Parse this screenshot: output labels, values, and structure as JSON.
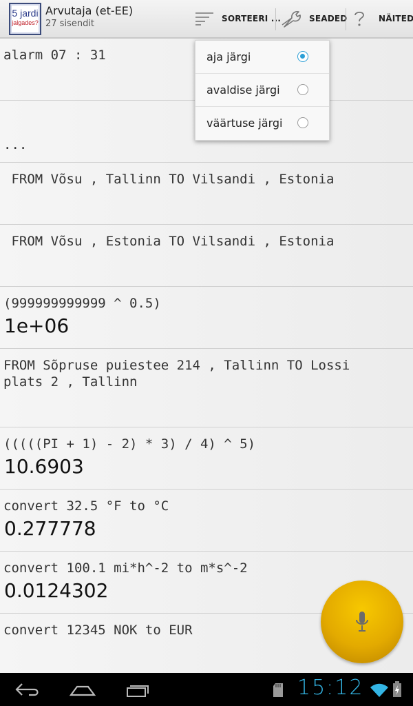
{
  "app": {
    "icon_line1": "5 jardi",
    "icon_line2": "jalgades?",
    "title": "Arvutaja (et-EE)",
    "subtitle": "27 sisendit"
  },
  "toolbar": {
    "sort_label": "SORTEERI ...",
    "settings_label": "SEADED",
    "examples_label": "NÄITED"
  },
  "sort_menu": {
    "options": [
      {
        "label": "aja järgi",
        "selected": true
      },
      {
        "label": "avaldise järgi",
        "selected": false
      },
      {
        "label": "väärtuse järgi",
        "selected": false
      }
    ]
  },
  "entries": [
    {
      "expression": "alarm 07 : 31",
      "result": ""
    },
    {
      "expression": "...",
      "result": ""
    },
    {
      "expression": " FROM Võsu , Tallinn TO Vilsandi , Estonia",
      "result": ""
    },
    {
      "expression": " FROM Võsu , Estonia TO Vilsandi , Estonia",
      "result": ""
    },
    {
      "expression": "(999999999999 ^ 0.5)",
      "result": "1e+06"
    },
    {
      "expression": "FROM Sõpruse puiestee 214 , Tallinn TO Lossi\nplats 2 , Tallinn",
      "result": ""
    },
    {
      "expression": "(((((PI + 1) - 2) * 3) / 4) ^ 5)",
      "result": "10.6903"
    },
    {
      "expression": "convert 32.5 °F to °C",
      "result": "0.277778"
    },
    {
      "expression": "convert 100.1 mi*h^-2 to m*s^-2",
      "result": "0.0124302"
    },
    {
      "expression": "convert 12345 NOK to EUR",
      "result": ""
    }
  ],
  "status_bar": {
    "time": "15:12"
  },
  "colors": {
    "accent": "#2c9fd6",
    "fab": "#e3aa00",
    "clock": "#33b5e5"
  },
  "icons": [
    "sort-icon",
    "wrench-icon",
    "help-icon",
    "microphone-icon",
    "back-icon",
    "home-icon",
    "recent-apps-icon",
    "sd-card-icon",
    "wifi-icon",
    "battery-icon"
  ]
}
